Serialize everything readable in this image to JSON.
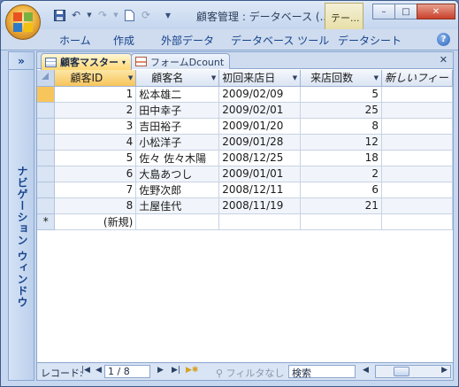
{
  "window": {
    "title": "顧客管理 : データベース (...",
    "context_tab": "テー...",
    "buttons": {
      "minimize": "–",
      "maximize": "□",
      "close": "✕"
    }
  },
  "quick_access": [
    "save-icon",
    "undo-icon",
    "redo-icon",
    "new-icon",
    "refresh-icon",
    "customize-icon"
  ],
  "ribbon": {
    "tabs": [
      "ホーム",
      "作成",
      "外部データ",
      "データベース ツール",
      "データシート"
    ],
    "help": "?"
  },
  "nav_pane": {
    "toggle": "»",
    "label": "ナビゲーション ウィンドウ"
  },
  "doc_tabs": [
    {
      "label": "顧客マスター",
      "active": true
    },
    {
      "label": "フォームDcount",
      "active": false
    }
  ],
  "grid": {
    "columns": [
      "顧客ID",
      "顧客名",
      "初回来店日",
      "来店回数",
      "新しいフィー"
    ],
    "rows": [
      [
        "1",
        "松本雄二",
        "2009/02/09",
        "5"
      ],
      [
        "2",
        "田中幸子",
        "2009/02/01",
        "25"
      ],
      [
        "3",
        "吉田裕子",
        "2009/01/20",
        "8"
      ],
      [
        "4",
        "小松洋子",
        "2009/01/28",
        "12"
      ],
      [
        "5",
        "佐々 佐々木陽",
        "2008/12/25",
        "18"
      ],
      [
        "6",
        "大島あつし",
        "2009/01/01",
        "2"
      ],
      [
        "7",
        "佐野次郎",
        "2008/12/11",
        "6"
      ],
      [
        "8",
        "土屋佳代",
        "2008/11/19",
        "21"
      ]
    ],
    "new_row_marker": "*",
    "new_row_label": "(新規)"
  },
  "recordbar": {
    "label": "レコード:",
    "position": "1 / 8",
    "filter": "フィルタなし",
    "search": "検索"
  }
}
